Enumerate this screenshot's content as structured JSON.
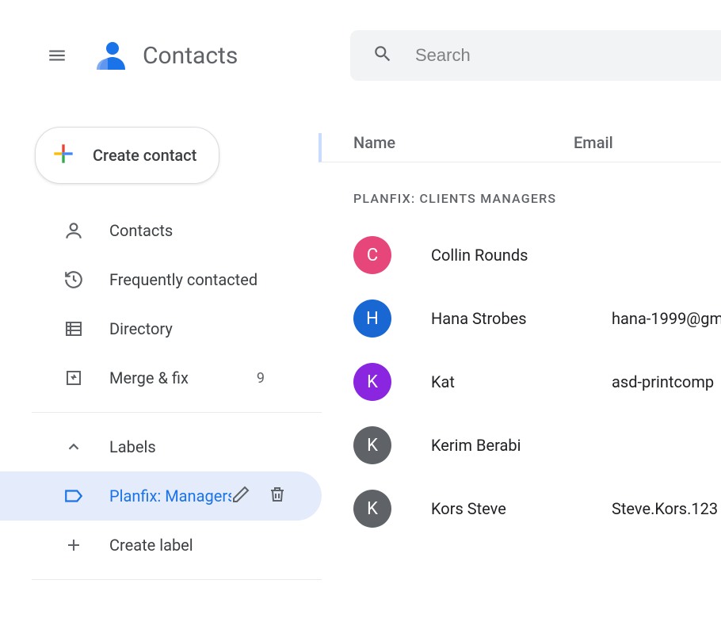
{
  "header": {
    "app_title": "Contacts",
    "search_placeholder": "Search"
  },
  "sidebar": {
    "create_label": "Create contact",
    "nav": [
      {
        "icon": "person",
        "label": "Contacts"
      },
      {
        "icon": "history",
        "label": "Frequently contacted"
      },
      {
        "icon": "directory",
        "label": "Directory"
      },
      {
        "icon": "merge",
        "label": "Merge & fix",
        "count": "9"
      }
    ],
    "labels_header": "Labels",
    "selected_label": "Planfix: Managers",
    "create_label_item": "Create label"
  },
  "main": {
    "columns": {
      "name": "Name",
      "email": "Email"
    },
    "section_header": "PLANFIX: CLIENTS MANAGERS",
    "rows": [
      {
        "initial": "C",
        "color": "#e6467a",
        "name": "Collin Rounds",
        "email": ""
      },
      {
        "initial": "H",
        "color": "#1967d2",
        "name": "Hana Strobes",
        "email": "hana-1999@gm"
      },
      {
        "initial": "K",
        "color": "#8a25e0",
        "name": "Kat",
        "email": "asd-printcomp"
      },
      {
        "initial": "K",
        "color": "#5f6368",
        "name": "Kerim Berabi",
        "email": ""
      },
      {
        "initial": "K",
        "color": "#5f6368",
        "name": "Kors Steve",
        "email": "Steve.Kors.123"
      }
    ]
  }
}
